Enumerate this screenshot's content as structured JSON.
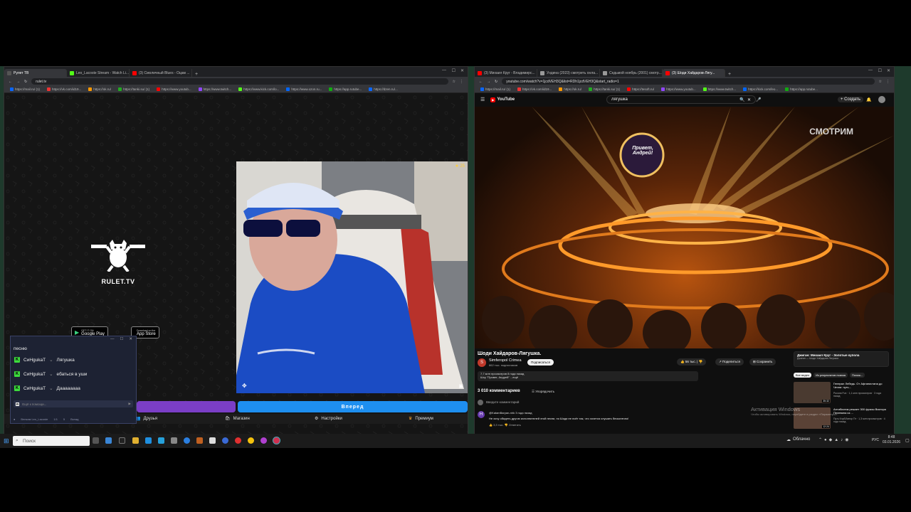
{
  "left_browser": {
    "tabs": [
      {
        "label": "Рулет ТВ",
        "color": "#333333"
      },
      {
        "label": "Leo_Lacoste Stream - Watch Li...",
        "color": "#53fc18"
      },
      {
        "label": "(3) Смоличный Blues - Оцам ...",
        "color": "#ff0000"
      }
    ],
    "url": "rulet.tv",
    "bookmarks": [
      "https://mail.ru/ (1)",
      "https://vk.com/id19...",
      "https://ok.ru/",
      "https://tanki.su/ (1)",
      "https://www.youtub...",
      "https://www.twitch...",
      "https://www.kick.com/lo...",
      "https://www.ozon.ru...",
      "https://app.rutube...",
      "https://dzen.ru/..."
    ],
    "page": {
      "logo_text": "RULET.TV",
      "google_play": {
        "small": "GET IT ON",
        "label": "Google Play"
      },
      "app_store": {
        "small": "Download on the",
        "label": "App Store"
      },
      "viewer_count": "25",
      "play_button": "Вперед",
      "nav": {
        "friends": "Друзья",
        "shop": "Магазин",
        "settings": "Настройки",
        "premium": "Премиум",
        "welcome": "Велкам Leo_Lacoste",
        "left_count_a": "1/1",
        "left_count_b": "5",
        "left_count_c": "Вклад"
      }
    }
  },
  "chat_popup": {
    "title": "песню",
    "messages": [
      {
        "user": "CиНgukaT",
        "text": "Лягушка"
      },
      {
        "user": "CиНgukaT",
        "text": "ебаться в уши"
      },
      {
        "user": "CиНgukaT",
        "text": "Даааааааа"
      }
    ],
    "input_placeholder": "Ещё к помощи..."
  },
  "right_browser": {
    "tabs": [
      {
        "label": "(3) Михаил Круг - Владимирс...",
        "color": "#ff0000"
      },
      {
        "label": "Ундина (2023) смотреть онла...",
        "color": "#999999"
      },
      {
        "label": "Седьмой ноябрь (2001) смотр...",
        "color": "#999999"
      },
      {
        "label": "(3) Шоди Хайдаров-Лягу...",
        "color": "#ff0000"
      }
    ],
    "url": "youtube.com/watch?v=1jcdVEH3Q&list=RDh1jcdVEH3Q&start_radio=1",
    "bookmarks": [
      "https://mail.ru/ (1)",
      "https://vk.com/id19...",
      "https://ok.ru/",
      "https://tanki.su/ (1)",
      "https://tesoft.ru/",
      "https://www.youtub...",
      "https://www.twitch...",
      "https://kick.com/leo...",
      "https://app.rutube..."
    ],
    "youtube": {
      "logo": "YouTube",
      "search_value": "лягушка",
      "create_label": "Создать",
      "watermark": "СМОТРИМ",
      "show_sign": "Привет, Андрей!",
      "video_title": "Шоди Хайдаров-Лягушка.",
      "channel": "Simferopol Crimea",
      "subscribers": "862 тыс. подписчиков",
      "subscribe": "Подписаться",
      "likes": "56 тыс.",
      "share": "Поделиться",
      "save": "Сохранить",
      "views": "7,7 млн просмотров  8 года назад",
      "desc": "Шоу \"Привет, Андрей\" ...ещё",
      "comments_count": "3 010 комментариев",
      "sort": "Упорядочить",
      "add_comment": "Введите комментарий",
      "comment_author": "@KatamBaryan-nhk 3 года назад",
      "comment_text": "Не хочу обидеть других исполнителей этой песни, но Шоди ее поёт так, что хочется слушать бесконечно!",
      "comment_reply": "Ответить",
      "comment_likes": "3,3 тыс.",
      "playlist": {
        "title": "Джиган: Михаил Круг - Золотые купола",
        "subtitle": "Джиган — Шоди Хайдаров-Лягушка"
      },
      "chips": [
        "Все видео",
        "Из результатов поиска",
        "Похож..."
      ],
      "recs": [
        {
          "title": "Генерал Лебедь. От Афганистана до Чечни: путь...",
          "meta": "Россия Fun · 1,1 млн просмотров · 3 года назад",
          "duration": "35:32"
        },
        {
          "title": "Антибиотик решает 300 фразы Виктора Пелевина из ...",
          "meta": "Путь Клуб/Автор Пт · 1,3 млн просмотров · 4 года назад",
          "duration": "12:24"
        }
      ]
    }
  },
  "activation": {
    "title": "Активация Windows",
    "subtitle": "Чтобы активировать Windows, перейдите в раздел «Параметры»."
  },
  "taskbar": {
    "search_placeholder": "Поиск",
    "weather": "Облачно",
    "language": "РУС",
    "time": "8:48",
    "date": "03.01.2026"
  }
}
